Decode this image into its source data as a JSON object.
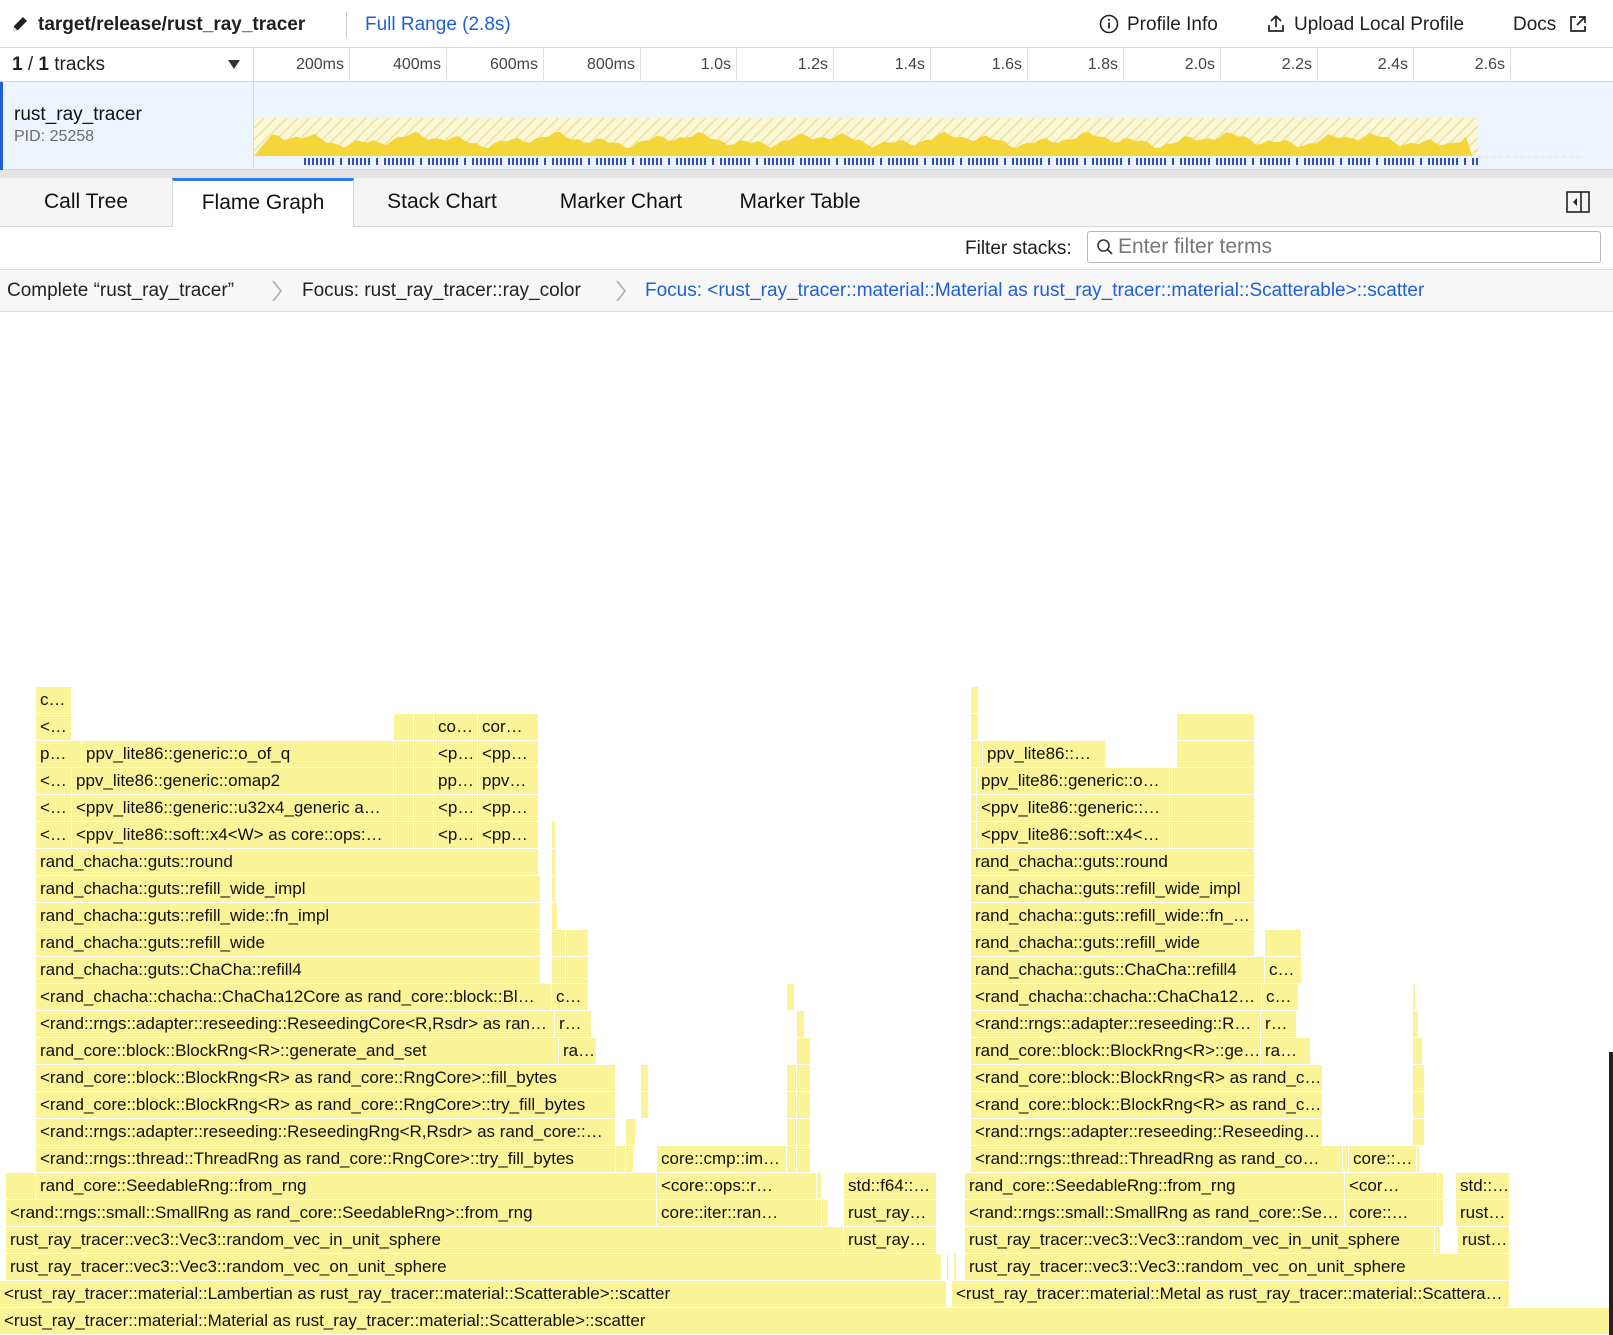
{
  "topbar": {
    "path": "target/release/rust_ray_tracer",
    "range": "Full Range (2.8s)",
    "profile_info": "Profile Info",
    "upload": "Upload Local Profile",
    "docs": "Docs"
  },
  "tracks": {
    "current": "1",
    "total": "1",
    "word": "tracks"
  },
  "timeline_ticks": [
    "200ms",
    "400ms",
    "600ms",
    "800ms",
    "1.0s",
    "1.2s",
    "1.4s",
    "1.6s",
    "1.8s",
    "2.0s",
    "2.2s",
    "2.4s",
    "2.6s"
  ],
  "track": {
    "name": "rust_ray_tracer",
    "pid": "PID: 25258"
  },
  "tabs": [
    "Call Tree",
    "Flame Graph",
    "Stack Chart",
    "Marker Chart",
    "Marker Table"
  ],
  "selected_tab": "Flame Graph",
  "filter": {
    "label": "Filter stacks:",
    "placeholder": "Enter filter terms"
  },
  "breadcrumbs": [
    "Complete “rust_ray_tracer”",
    "Focus: rust_ray_tracer::ray_color",
    "Focus: <rust_ray_tracer::material::Material as rust_ray_tracer::material::Scatterable>::scatter"
  ],
  "colors": {
    "frame": "#faf397",
    "accent": "#1f5fd6",
    "graph": "#f4d63b",
    "samples": "#2f4fb8"
  },
  "frame_labels": [
    "<rust_ray_tracer::material::Material as rust_ray_tracer::material::Scatterable>::scatter",
    "<rust_ray_tracer::material::Lambertian as rust_ray_tracer::material::Scatterable>::scatter",
    "<rust_ray_tracer::material::Metal as rust_ray_tracer::material::Scattera…",
    "rust_ray_tracer::vec3::Vec3::random_vec_on_unit_sphere",
    "rust_ray_tracer::vec3::Vec3::random_vec_on_unit_sphere",
    "rust_ray_tracer::vec3::Vec3::random_vec_in_unit_sphere",
    "rust_ray…",
    "rust_ray_tracer::vec3::Vec3::random_vec_in_unit_sphere",
    "rust…",
    "<rand::rngs::small::SmallRng as rand_core::SeedableRng>::from_rng",
    "core::iter::ran…",
    "rust_ray…",
    "<rand::rngs::small::SmallRng as rand_core::Se…",
    "core::…",
    "rust…",
    "rand_core::SeedableRng::from_rng",
    "<core::ops::r…",
    "std::f64::…",
    "rand_core::SeedableRng::from_rng",
    "<cor…",
    "std::…",
    "<rand::rngs::thread::ThreadRng as rand_core::RngCore>::try_fill_bytes",
    "core::cmp::im…",
    "<rand::rngs::thread::ThreadRng as rand_co…",
    "core::…",
    "<rand::rngs::adapter::reseeding::ReseedingRng<R,Rsdr> as rand_core::…",
    "<rand::rngs::adapter::reseeding::Reseeding…",
    "<rand_core::block::BlockRng<R> as rand_core::RngCore>::try_fill_bytes",
    "<rand_core::block::BlockRng<R> as rand_c…",
    "<rand_core::block::BlockRng<R> as rand_core::RngCore>::fill_bytes",
    "<rand_core::block::BlockRng<R> as rand_c…",
    "rand_core::block::BlockRng<R>::generate_and_set",
    "ra…",
    "rand_core::block::BlockRng<R>::ge…",
    "ra…",
    "<rand::rngs::adapter::reseeding::ReseedingCore<R,Rsdr> as ran…",
    "r…",
    "<rand::rngs::adapter::reseeding::R…",
    "r…",
    "<rand_chacha::chacha::ChaCha12Core as rand_core::block::Bl…",
    "c…",
    "<rand_chacha::chacha::ChaCha12…",
    "c…",
    "rand_chacha::guts::ChaCha::refill4",
    "rand_chacha::guts::ChaCha::refill4",
    "c…",
    "rand_chacha::guts::refill_wide",
    "rand_chacha::guts::refill_wide",
    "rand_chacha::guts::refill_wide::fn_impl",
    "rand_chacha::guts::refill_wide::fn_…",
    "rand_chacha::guts::refill_wide_impl",
    "rand_chacha::guts::refill_wide_impl",
    "rand_chacha::guts::round",
    "rand_chacha::guts::round",
    "<…",
    "<ppv_lite86::soft::x4<W> as core::ops:…",
    "<p…",
    "<pp…",
    "<ppv_lite86::soft::x4<…",
    "<…",
    "<ppv_lite86::generic::u32x4_generic a…",
    "<p…",
    "<pp…",
    "<ppv_lite86::generic::…",
    "<…",
    "ppv_lite86::generic::omap2",
    "pp…",
    "ppv…",
    "ppv_lite86::generic::o…",
    "p…",
    "ppv_lite86::generic::o_of_q",
    "<p…",
    "<pp…",
    "ppv_lite86::…",
    "<…",
    "co…",
    "cor…",
    "c…"
  ]
}
